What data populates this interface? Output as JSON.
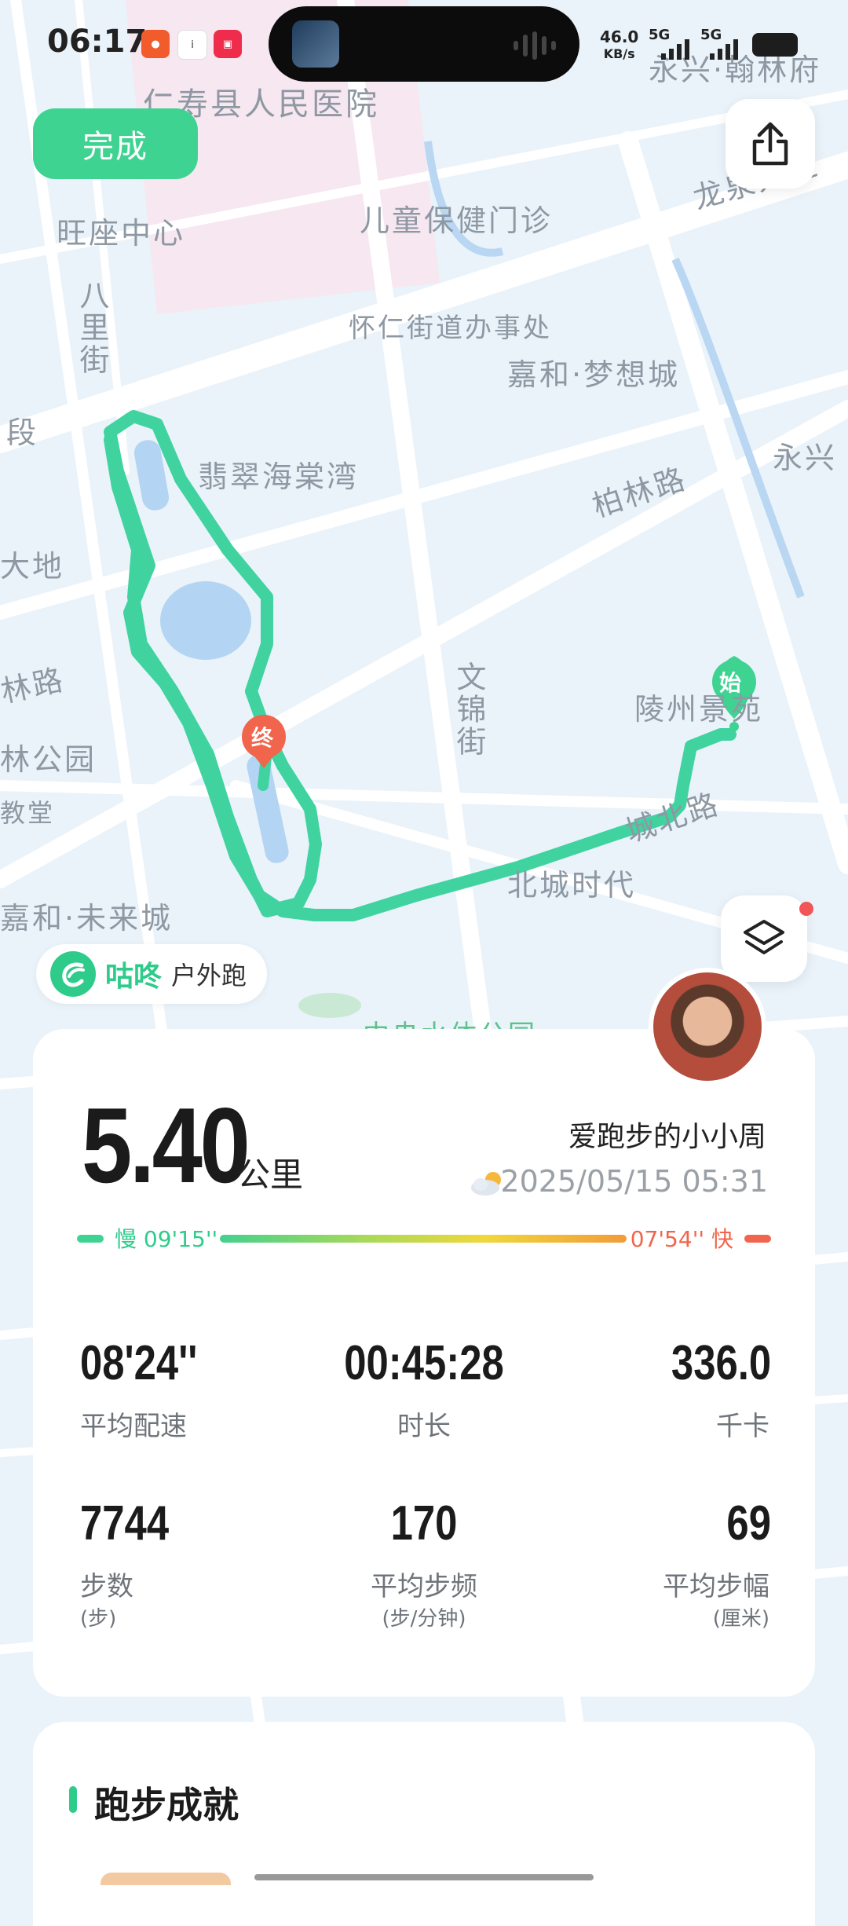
{
  "status_bar": {
    "time": "06:17",
    "net_speed_value": "46.0",
    "net_speed_unit": "KB/s",
    "signal_1": "5G",
    "signal_2": "5G"
  },
  "map": {
    "labels": {
      "hospital": "仁寿县人民医院",
      "wangzuo": "旺座中心",
      "child_clinic": "儿童保健门诊",
      "huairen": "怀仁街道办事处",
      "jiahe_dream": "嘉和·梦想城",
      "bali_street": "八里街",
      "duan": "段",
      "feicui": "翡翠海棠湾",
      "bailin_road": "柏林路",
      "yongxing": "永兴",
      "dadi": "大地",
      "lin_road": "林路",
      "wenjin_street": "文锦街",
      "lingzhou": "陵州景苑",
      "lin_park": "林公园",
      "chengbei_road": "城北路",
      "jiaotang": "教堂",
      "beicheng_times": "北城时代",
      "jiahe_future": "嘉和·未来城",
      "water_park": "中央水体公园",
      "yongxing_hanlin": "永兴·翰林府",
      "long_road": "龙泉大道",
      "start_marker": "始",
      "end_marker": "终"
    }
  },
  "toolbar": {
    "done_label": "完成"
  },
  "brand": {
    "name": "咕咚",
    "subtitle": "户外跑"
  },
  "summary": {
    "distance": "5.40",
    "distance_unit": "公里",
    "user_name": "爱跑步的小小周",
    "datetime": "2025/05/15 05:31",
    "pace_slow_label": "慢 09'15''",
    "pace_fast_label": "07'54'' 快"
  },
  "metrics": [
    {
      "value": "08'24''",
      "label": "平均配速",
      "unit": ""
    },
    {
      "value": "00:45:28",
      "label": "时长",
      "unit": ""
    },
    {
      "value": "336.0",
      "label": "千卡",
      "unit": ""
    },
    {
      "value": "7744",
      "label": "步数",
      "unit": "(步)"
    },
    {
      "value": "170",
      "label": "平均步频",
      "unit": "(步/分钟)"
    },
    {
      "value": "69",
      "label": "平均步幅",
      "unit": "(厘米)"
    }
  ],
  "achievements": {
    "title": "跑步成就"
  },
  "colors": {
    "accent": "#3fd392",
    "route": "#40d3a0",
    "end_marker": "#f0654b",
    "fast": "#f0654b"
  }
}
